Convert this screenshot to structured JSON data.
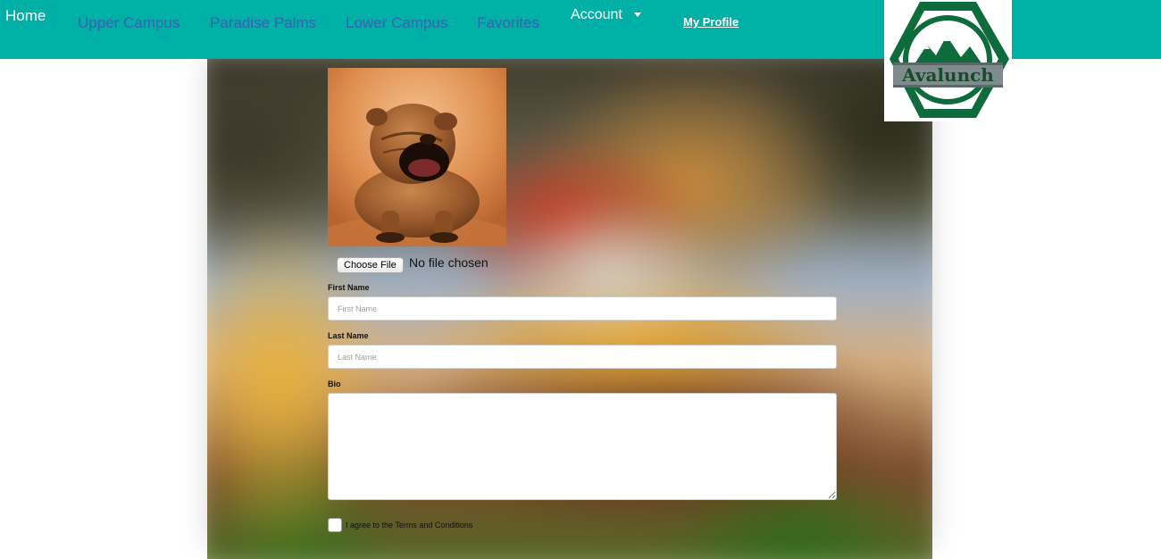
{
  "nav": {
    "home": "Home",
    "upper_campus": "Upper Campus",
    "paradise_palms": "Paradise Palms",
    "lower_campus": "Lower Campus",
    "favorites": "Favorites",
    "account": "Account",
    "my_profile": "My Profile"
  },
  "logo": {
    "text": "Avalunch"
  },
  "colors": {
    "navbar": "#00b0a6",
    "nav_link": "#3b5fb3",
    "logo_green": "#0e6b3c"
  },
  "profile_form": {
    "avatar_alt": "profile photo",
    "choose_file_label": "Choose File",
    "file_status": "No file chosen",
    "first_name_label": "First Name",
    "first_name_placeholder": "First Name",
    "first_name_value": "",
    "last_name_label": "Last Name",
    "last_name_placeholder": "Last Name",
    "last_name_value": "",
    "bio_label": "Bio",
    "bio_value": "",
    "terms_label": "I agree to the Terms and Conditions",
    "terms_checked": false
  },
  "icons": {
    "account_dropdown": "caret-down-icon",
    "logo": "mountain-hexagon-logo"
  }
}
